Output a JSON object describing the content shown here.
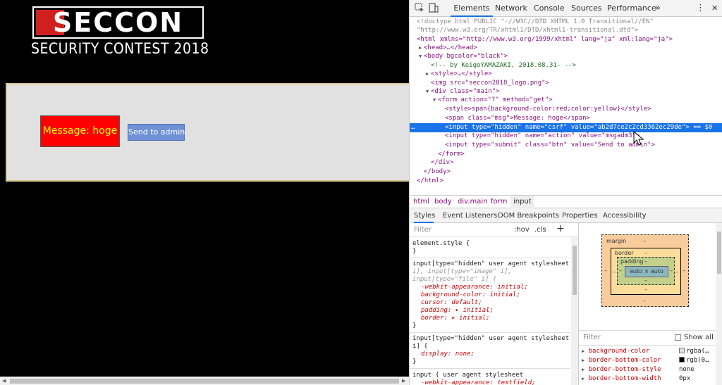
{
  "page": {
    "logo_text": "SECCON",
    "tagline": "SECURITY CONTEST 2018",
    "message": "Message: hoge",
    "send_button": "Send to admin"
  },
  "devtools": {
    "tabs": [
      "Elements",
      "Network",
      "Console",
      "Sources",
      "Performance"
    ],
    "more_tabs": "»",
    "menu": "⋮",
    "close": "✕",
    "dom_lines": [
      {
        "text": "<!doctype html PUBLIC \"-//W3C//DTD XHTML 1.0 Transitional//EN\""
      },
      {
        "text": "\"http://www.w3.org/TR/xhtml1/DTD/xhtml1-transitional.dtd\">"
      },
      {
        "text": "<html xmlns=\"http://www.w3.org/1999/xhtml\" lang=\"ja\" xml:lang=\"ja\">"
      },
      {
        "text": "<head>…</head>"
      },
      {
        "text": "<body bgcolor=\"black\">"
      },
      {
        "text": "<!-- by KeigoYAMAZAKI, 2018.08.31- -->"
      },
      {
        "text": "<style>…</style>"
      },
      {
        "text": "<img src=\"seccon2018_logo.png\">"
      },
      {
        "text": "<div class=\"main\">"
      },
      {
        "text": "<form action=\"?\" method=\"get\">"
      },
      {
        "text": "<style>span{background-color:red;color:yellow}</style>"
      },
      {
        "text": "<span class=\"msg\">Message: hoge</span>"
      },
      {
        "text": "<input type=\"hidden\" name=\"csrf\" value=\"ab2d7ce2c2cd3362ec29de\"> == $0"
      },
      {
        "text": "<input type=\"hidden\" name=\"action\" value=\"msgadm3\">"
      },
      {
        "text": "<input type=\"submit\" class=\"btn\" value=\"Send to admin\">"
      },
      {
        "text": "</form>"
      },
      {
        "text": "</div>"
      },
      {
        "text": "</body>"
      },
      {
        "text": "</html>"
      }
    ],
    "selected_marker": "…",
    "breadcrumbs": [
      "html",
      "body",
      "div.main",
      "form",
      "input"
    ],
    "subtabs": [
      "Styles",
      "Event Listeners",
      "DOM Breakpoints",
      "Properties",
      "Accessibility"
    ],
    "styles": {
      "filter_placeholder": "Filter",
      "hov": ":hov",
      "cls": ".cls",
      "plus": "+",
      "lines": [
        "element.style {",
        "}",
        "input[type=\"hidden\"  user agent stylesheet",
        "i], input[type=\"image\" i],",
        "input[type=\"file\" i] {",
        "-webkit-appearance: initial;",
        "background-color: initial;",
        "cursor: default;",
        "padding: ▸ initial;",
        "border: ▸ initial;",
        "}",
        "input[type=\"hidden\"  user agent stylesheet",
        "i] {",
        "display: none;",
        "}",
        "input {                user agent stylesheet",
        "-webkit-appearance: textfield;"
      ]
    },
    "box_model": {
      "margin_label": "margin",
      "border_label": "border",
      "padding_label": "padding",
      "content": "auto × auto",
      "dash": "–"
    },
    "computed": {
      "filter_placeholder": "Filter",
      "show_all": "Show all",
      "props": [
        {
          "name": "background-color",
          "value": "rgba(…",
          "swatch": "#e0e0e0"
        },
        {
          "name": "border-bottom-color",
          "value": "rgb(0…",
          "swatch": "#000000"
        },
        {
          "name": "border-bottom-style",
          "value": "none",
          "swatch": ""
        },
        {
          "name": "border-bottom-width",
          "value": "0px",
          "swatch": ""
        }
      ]
    }
  }
}
